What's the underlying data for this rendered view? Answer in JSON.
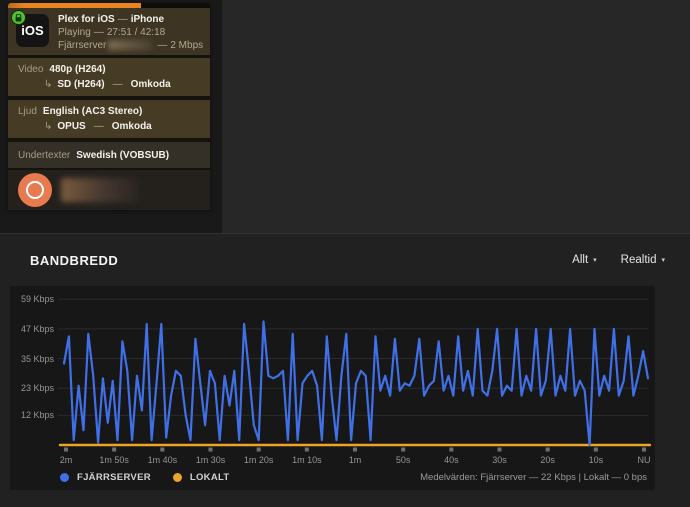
{
  "icons": {
    "caret_down": "▾",
    "transcode_arrow": "↳"
  },
  "now_playing": {
    "badge": "iOS",
    "app": "Plex for iOS",
    "sep": "—",
    "device": "iPhone",
    "state": "Playing",
    "time": "27:51 / 42:18",
    "source": "Fjärrserver",
    "bitrate": "2 Mbps",
    "progress_percent": 66,
    "video": {
      "label": "Video",
      "value": "480p (H264)",
      "transcode_target": "SD (H264)",
      "transcode_action": "Omkoda"
    },
    "audio": {
      "label": "Ljud",
      "value": "English (AC3 Stereo)",
      "transcode_target": "OPUS",
      "transcode_action": "Omkoda"
    },
    "subtitles": {
      "label": "Undertexter",
      "value": "Swedish (VOBSUB)"
    }
  },
  "bandwidth": {
    "title": "BANDBREDD",
    "filters": [
      {
        "label": "Allt"
      },
      {
        "label": "Realtid"
      }
    ],
    "legend": [
      {
        "label": "FJÄRRSERVER",
        "color": "#4070e8"
      },
      {
        "label": "LOKALT",
        "color": "#eea32b"
      }
    ],
    "summary": "Medelvärden: Fjärrserver — 22 Kbps | Lokalt — 0 bps"
  },
  "chart_data": {
    "type": "line",
    "title": "BANDBREDD",
    "unit": "Kbps",
    "x_ticks": [
      "2m",
      "1m 50s",
      "1m 40s",
      "1m 30s",
      "1m 20s",
      "1m 10s",
      "1m",
      "50s",
      "40s",
      "30s",
      "20s",
      "10s",
      "NU"
    ],
    "y_ticks": [
      "59 Kbps",
      "47 Kbps",
      "35 Kbps",
      "23 Kbps",
      "12 Kbps"
    ],
    "y_tick_values": [
      59,
      47,
      35,
      23,
      12
    ],
    "ylim": [
      0,
      62
    ],
    "grid": true,
    "legend_position": "bottom-left",
    "series": [
      {
        "name": "FJÄRRSERVER",
        "color": "#4070e8",
        "values": [
          33,
          44,
          2,
          24,
          6,
          45,
          28,
          1,
          27,
          9,
          26,
          2,
          42,
          30,
          2,
          28,
          14,
          49,
          2,
          25,
          49,
          3,
          20,
          30,
          28,
          12,
          2,
          43,
          25,
          8,
          30,
          25,
          2,
          28,
          16,
          30,
          2,
          49,
          30,
          8,
          2,
          50,
          28,
          27,
          28,
          30,
          2,
          45,
          2,
          25,
          28,
          30,
          24,
          2,
          44,
          20,
          2,
          28,
          45,
          2,
          25,
          30,
          28,
          2,
          44,
          22,
          28,
          20,
          43,
          22,
          25,
          24,
          28,
          43,
          20,
          24,
          26,
          42,
          22,
          28,
          20,
          44,
          22,
          30,
          20,
          47,
          22,
          20,
          30,
          47,
          20,
          24,
          22,
          47,
          20,
          28,
          22,
          47,
          20,
          26,
          47,
          20,
          28,
          22,
          47,
          20,
          26,
          22,
          0,
          47,
          20,
          28,
          22,
          47,
          20,
          26,
          44,
          20,
          28,
          38,
          27
        ]
      },
      {
        "name": "LOKALT",
        "color": "#eea32b",
        "constant": 0
      }
    ]
  }
}
